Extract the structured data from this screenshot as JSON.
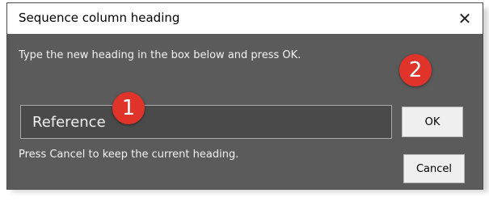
{
  "dialog": {
    "title": "Sequence column heading",
    "close_glyph": "✕",
    "instruction": "Type the new heading in the box below and press OK.",
    "input_value": "Reference",
    "hint": "Press Cancel to keep the current heading.",
    "ok_label": "OK",
    "cancel_label": "Cancel"
  },
  "callouts": {
    "marker_1": "1",
    "marker_2": "2",
    "color": "#e0332a"
  },
  "icons": {
    "close": "close-icon"
  }
}
